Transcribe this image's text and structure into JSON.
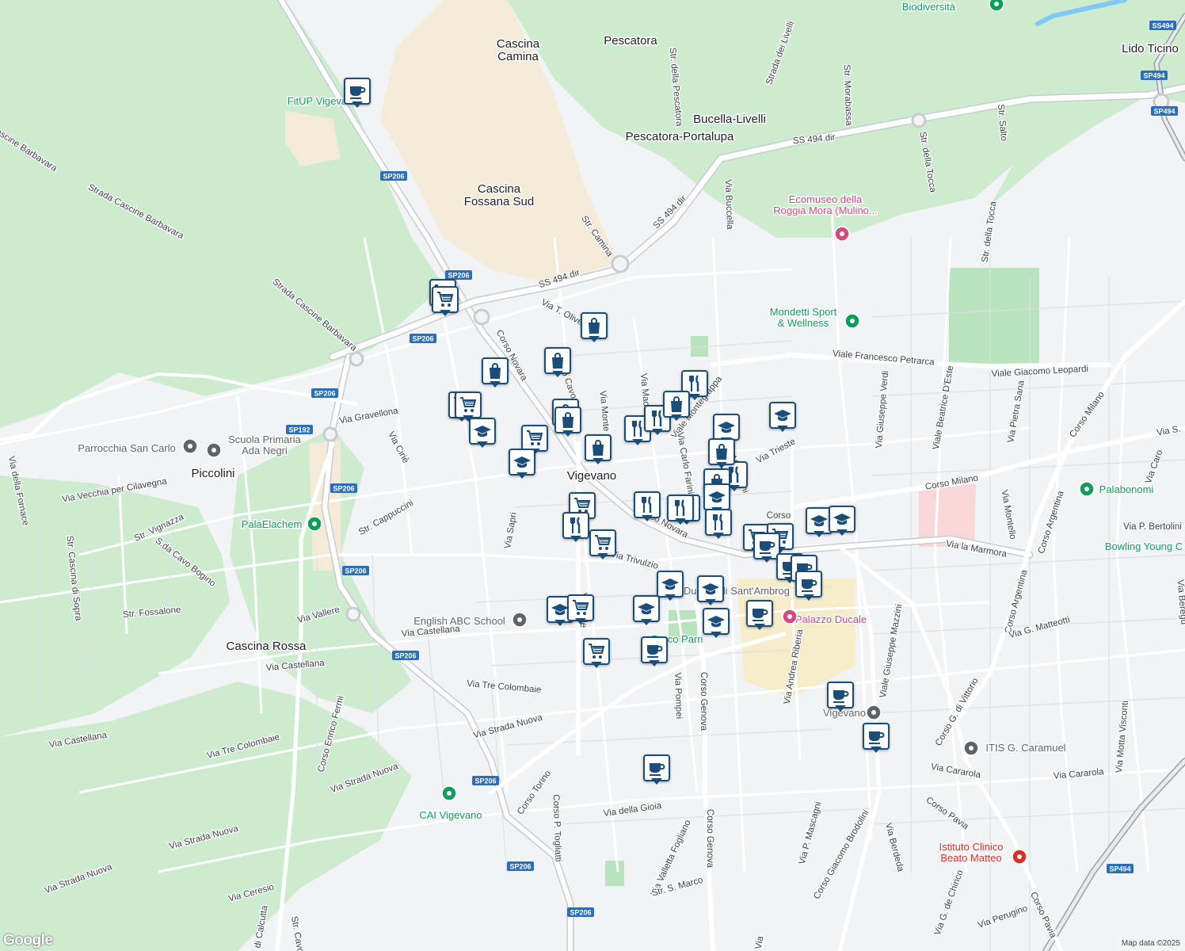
{
  "map": {
    "attribution": "Map data ©2025",
    "logo": "Google",
    "colors": {
      "park": "#c8e6c9",
      "urban": "#f1f3f4",
      "road": "#ffffff",
      "minor": "#dadce0",
      "marker_border": "#1a4d7a",
      "highway_shield": "#2c6fb8",
      "poi_green": "#0f9d58",
      "poi_pink": "#d24b7c",
      "poi_gray": "#5f6368",
      "poi_red": "#d93025"
    },
    "places": [
      {
        "id": "cascina-camina",
        "text": [
          "Cascina",
          "Camina"
        ]
      },
      {
        "id": "pescatora",
        "text": [
          "Pescatora"
        ]
      },
      {
        "id": "bucella-livelli",
        "text": [
          "Bucella-Livelli"
        ]
      },
      {
        "id": "pescatora-portalupa",
        "text": [
          "Pescatora-Portalupa"
        ]
      },
      {
        "id": "cascina-fossana",
        "text": [
          "Cascina",
          "Fossana Sud"
        ]
      },
      {
        "id": "lido-ticino",
        "text": [
          "Lido Ticino"
        ]
      },
      {
        "id": "piccolini",
        "text": [
          "Piccolini"
        ]
      },
      {
        "id": "vigevano",
        "text": [
          "Vigevano"
        ]
      },
      {
        "id": "cascina-rossa",
        "text": [
          "Cascina Rossa"
        ]
      }
    ],
    "pois": [
      {
        "id": "biodiversita",
        "text": [
          "Biodiversità"
        ],
        "kind": "green"
      },
      {
        "id": "ecomuseo",
        "text": [
          "Ecomuseo della",
          "Roggia Mora (Mulino..."
        ],
        "kind": "pink"
      },
      {
        "id": "mondetti",
        "text": [
          "Mondetti Sport",
          "& Wellness"
        ],
        "kind": "green"
      },
      {
        "id": "parrocchia",
        "text": [
          "Parrocchia San Carlo"
        ],
        "kind": "gray"
      },
      {
        "id": "scuola-negri",
        "text": [
          "Scuola Primaria",
          "Ada Negri"
        ],
        "kind": "gray"
      },
      {
        "id": "palaelachem",
        "text": [
          "PalaElachem"
        ],
        "kind": "green"
      },
      {
        "id": "english-abc",
        "text": [
          "English ABC School"
        ],
        "kind": "gray"
      },
      {
        "id": "palazzo-ducale",
        "text": [
          "Palazzo Ducale"
        ],
        "kind": "pink"
      },
      {
        "id": "vigevano-station",
        "text": [
          "Vigevano"
        ],
        "kind": "gray"
      },
      {
        "id": "itis",
        "text": [
          "ITIS G. Caramuel"
        ],
        "kind": "gray"
      },
      {
        "id": "cai",
        "text": [
          "CAI Vigevano"
        ],
        "kind": "green"
      },
      {
        "id": "palabonomi",
        "text": [
          "Palabonomi"
        ],
        "kind": "green"
      },
      {
        "id": "bowling",
        "text": [
          "Bowling Young C"
        ],
        "kind": "green"
      },
      {
        "id": "istituto",
        "text": [
          "Istituto Clinico",
          "Beato Matteo"
        ],
        "kind": "red"
      },
      {
        "id": "fitup",
        "text": [
          "FitUP Vigevan"
        ],
        "kind": "green"
      },
      {
        "id": "parco-parri",
        "text": [
          "Parco Parri"
        ],
        "kind": "green"
      },
      {
        "id": "duomo",
        "text": [
          "Duomo di Sant'Ambrog"
        ],
        "kind": "gray"
      }
    ],
    "streets": [
      {
        "id": "s1",
        "text": "Cascine Barbavara"
      },
      {
        "id": "s2",
        "text": "Strada Cascine Barbavara"
      },
      {
        "id": "s3",
        "text": "Strada Cascine Barbavara"
      },
      {
        "id": "s4",
        "text": "SS 494 dir"
      },
      {
        "id": "s5",
        "text": "SS 494 dir"
      },
      {
        "id": "s6",
        "text": "SS 494 dir"
      },
      {
        "id": "s7",
        "text": "Str. della Pescatora"
      },
      {
        "id": "s8",
        "text": "Strada dei Livelli"
      },
      {
        "id": "s9",
        "text": "Str. Morabassa"
      },
      {
        "id": "s10",
        "text": "Str. della Tocca"
      },
      {
        "id": "s11",
        "text": "Str. Salto"
      },
      {
        "id": "s12",
        "text": "Str. della Tocca"
      },
      {
        "id": "s13",
        "text": "Str. Camina"
      },
      {
        "id": "s14",
        "text": "Via Buccella"
      },
      {
        "id": "s15",
        "text": "Corso Novara"
      },
      {
        "id": "s16",
        "text": "Via T. Olive"
      },
      {
        "id": "s17",
        "text": "Viale Francesco Petrarca"
      },
      {
        "id": "s18",
        "text": "Viale Giacomo Leopardi"
      },
      {
        "id": "s19",
        "text": "Viale Montegrappa"
      },
      {
        "id": "s20",
        "text": "Via Gravellona"
      },
      {
        "id": "s21",
        "text": "Via Ciriè"
      },
      {
        "id": "s22",
        "text": "Via Vecchia per Cilavegna"
      },
      {
        "id": "s23",
        "text": "Via della Fornace"
      },
      {
        "id": "s24",
        "text": "Str. Vignazza"
      },
      {
        "id": "s25",
        "text": "S.da Cavo Bogino"
      },
      {
        "id": "s26",
        "text": "Str. Cascina di Sopra"
      },
      {
        "id": "s27",
        "text": "Str. Fossalone"
      },
      {
        "id": "s28",
        "text": "Str. Cappuccini"
      },
      {
        "id": "s29",
        "text": "Via Sapri"
      },
      {
        "id": "s30",
        "text": "Corso Novara"
      },
      {
        "id": "s31",
        "text": "Corso Milano"
      },
      {
        "id": "s32",
        "text": "Corso Milano"
      },
      {
        "id": "s33",
        "text": "Via la Marmora"
      },
      {
        "id": "s34",
        "text": "Via Trieste"
      },
      {
        "id": "s35",
        "text": "Via Giuseppe Verdi"
      },
      {
        "id": "s36",
        "text": "Viale Beatrice D'Este"
      },
      {
        "id": "s37",
        "text": "Via Pietra Sana"
      },
      {
        "id": "s38",
        "text": "Corso Argentina"
      },
      {
        "id": "s39",
        "text": "Corso Argentina"
      },
      {
        "id": "s40",
        "text": "Via Montello"
      },
      {
        "id": "s41",
        "text": "Via P. Bertolini"
      },
      {
        "id": "s42",
        "text": "Via G. Matteotti"
      },
      {
        "id": "s43",
        "text": "Via Vallere"
      },
      {
        "id": "s44",
        "text": "Via Castellana"
      },
      {
        "id": "s45",
        "text": "Via Castellana"
      },
      {
        "id": "s46",
        "text": "Via Castellana"
      },
      {
        "id": "s47",
        "text": "Via Tre Colombaie"
      },
      {
        "id": "s48",
        "text": "Via Tre Colombaie"
      },
      {
        "id": "s49",
        "text": "Via Strada Nuova"
      },
      {
        "id": "s50",
        "text": "Via Strada Nuova"
      },
      {
        "id": "s51",
        "text": "Via Strada Nuova"
      },
      {
        "id": "s52",
        "text": "Via Strada Nuova"
      },
      {
        "id": "s53",
        "text": "Corso Enrico Fermi"
      },
      {
        "id": "s54",
        "text": "Corso Torino"
      },
      {
        "id": "s55",
        "text": "Corso P. Togliatti"
      },
      {
        "id": "s56",
        "text": "Via della Gioia"
      },
      {
        "id": "s57",
        "text": "Via Pompei"
      },
      {
        "id": "s58",
        "text": "Corso Genova"
      },
      {
        "id": "s59",
        "text": "Corso Genova"
      },
      {
        "id": "s60",
        "text": "Via Valletta Fogliano"
      },
      {
        "id": "s61",
        "text": "Str. S. Marco"
      },
      {
        "id": "s62",
        "text": "Via Andrea Riberia"
      },
      {
        "id": "s63",
        "text": "Viale Giuseppe Mazzini"
      },
      {
        "id": "s64",
        "text": "Corso G. di Vittorio"
      },
      {
        "id": "s65",
        "text": "Via Cararola"
      },
      {
        "id": "s66",
        "text": "Via Cararola"
      },
      {
        "id": "s67",
        "text": "Corso Pavia"
      },
      {
        "id": "s68",
        "text": "Corso Pavia"
      },
      {
        "id": "s69",
        "text": "Corso Giacomo Brodolini"
      },
      {
        "id": "s70",
        "text": "Via P. Mascagni"
      },
      {
        "id": "s71",
        "text": "Via Berdeda"
      },
      {
        "id": "s72",
        "text": "Via G. de Chirico"
      },
      {
        "id": "s73",
        "text": "Via Perugino"
      },
      {
        "id": "s74",
        "text": "Via Motta Visconti"
      },
      {
        "id": "s75",
        "text": "Via Ceresio"
      },
      {
        "id": "s76",
        "text": "Via Trivulzio"
      },
      {
        "id": "s77",
        "text": "Via Carlo Farini"
      },
      {
        "id": "s78",
        "text": "Via Monte Nero"
      },
      {
        "id": "s79",
        "text": "Via Pietro Mascagni"
      },
      {
        "id": "s80",
        "text": "Via Caro"
      },
      {
        "id": "s81",
        "text": "Via S."
      },
      {
        "id": "s82",
        "text": "Via Beregu"
      },
      {
        "id": "s83",
        "text": "Corso"
      },
      {
        "id": "s84",
        "text": "Via"
      },
      {
        "id": "s85",
        "text": "di Calcutta"
      },
      {
        "id": "s86",
        "text": "Str. Cavo"
      },
      {
        "id": "s87",
        "text": "Corso Cavour"
      },
      {
        "id": "s88",
        "text": "Via Valle"
      },
      {
        "id": "s89",
        "text": "Via Madonna"
      }
    ],
    "shields": [
      {
        "id": "sh1",
        "text": "SP206"
      },
      {
        "id": "sh2",
        "text": "SP206"
      },
      {
        "id": "sh3",
        "text": "SP206"
      },
      {
        "id": "sh4",
        "text": "SP206"
      },
      {
        "id": "sh5",
        "text": "SP192"
      },
      {
        "id": "sh6",
        "text": "SP206"
      },
      {
        "id": "sh7",
        "text": "SP206"
      },
      {
        "id": "sh8",
        "text": "SP206"
      },
      {
        "id": "sh9",
        "text": "SP206"
      },
      {
        "id": "sh10",
        "text": "SP206"
      },
      {
        "id": "sh11",
        "text": "SP206"
      },
      {
        "id": "sh12",
        "text": "SS494"
      },
      {
        "id": "sh13",
        "text": "SP494"
      },
      {
        "id": "sh14",
        "text": "SP494"
      },
      {
        "id": "sh15",
        "text": "SP494"
      }
    ],
    "markers": [
      {
        "type": "cafe"
      },
      {
        "type": "grocery"
      },
      {
        "type": "grocery"
      },
      {
        "type": "shopping"
      },
      {
        "type": "shopping"
      },
      {
        "type": "shopping"
      },
      {
        "type": "grocery"
      },
      {
        "type": "grocery"
      },
      {
        "type": "school"
      },
      {
        "type": "shopping"
      },
      {
        "type": "shopping"
      },
      {
        "type": "grocery"
      },
      {
        "type": "school"
      },
      {
        "type": "shopping"
      },
      {
        "type": "restaurant"
      },
      {
        "type": "restaurant"
      },
      {
        "type": "restaurant"
      },
      {
        "type": "shopping"
      },
      {
        "type": "restaurant"
      },
      {
        "type": "school"
      },
      {
        "type": "school"
      },
      {
        "type": "shopping"
      },
      {
        "type": "restaurant"
      },
      {
        "type": "shopping"
      },
      {
        "type": "school"
      },
      {
        "type": "grocery"
      },
      {
        "type": "restaurant"
      },
      {
        "type": "restaurant"
      },
      {
        "type": "restaurant"
      },
      {
        "type": "grocery"
      },
      {
        "type": "restaurant"
      },
      {
        "type": "school"
      },
      {
        "type": "school"
      },
      {
        "type": "grocery"
      },
      {
        "type": "grocery"
      },
      {
        "type": "cafe"
      },
      {
        "type": "cafe"
      },
      {
        "type": "cafe"
      },
      {
        "type": "cafe"
      },
      {
        "type": "school"
      },
      {
        "type": "school"
      },
      {
        "type": "school"
      },
      {
        "type": "school"
      },
      {
        "type": "grocery"
      },
      {
        "type": "school"
      },
      {
        "type": "grocery"
      },
      {
        "type": "cafe"
      },
      {
        "type": "cafe"
      },
      {
        "type": "cafe"
      },
      {
        "type": "cafe"
      },
      {
        "type": "cafe"
      }
    ]
  }
}
